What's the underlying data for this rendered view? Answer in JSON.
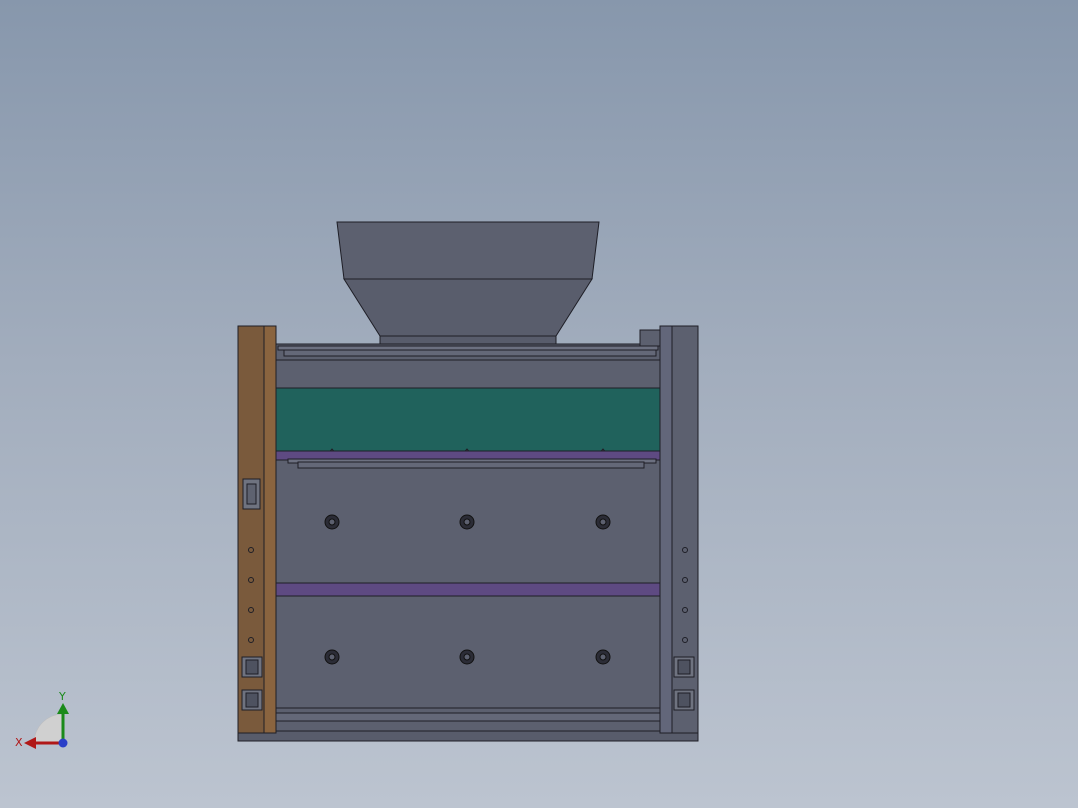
{
  "viewport": {
    "background_top": "#8797ac",
    "background_bottom": "#bcc4d0"
  },
  "model": {
    "panel_color": "#5c606f",
    "edge_color": "#1e1e26",
    "wood_color": "#7a5a3c",
    "green_band_color": "#20625c",
    "purple_band_color": "#5e4a82"
  },
  "triad": {
    "x_label": "X",
    "y_label": "Y",
    "x_color": "#b01818",
    "y_color": "#1a8a1a",
    "z_color": "#2a3fc8"
  }
}
